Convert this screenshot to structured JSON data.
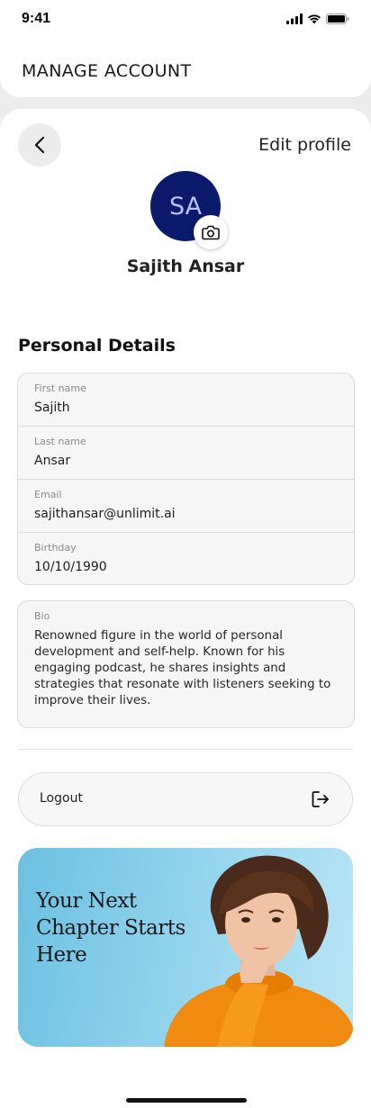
{
  "status_bar": {
    "time": "9:41"
  },
  "header": {
    "title": "MANAGE ACCOUNT"
  },
  "profile": {
    "edit_label": "Edit profile",
    "initials": "SA",
    "name": "Sajith Ansar"
  },
  "personal_details": {
    "title": "Personal Details",
    "fields": [
      {
        "label": "First name",
        "value": "Sajith"
      },
      {
        "label": "Last name",
        "value": "Ansar"
      },
      {
        "label": "Email",
        "value": "sajithansar@unlimit.ai"
      },
      {
        "label": "Birthday",
        "value": "10/10/1990"
      }
    ],
    "bio": {
      "label": "Bio",
      "value": "Renowned figure in the world of personal development and self-help. Known for his engaging podcast, he shares insights and strategies that resonate with listeners seeking to improve their lives."
    }
  },
  "logout": {
    "label": "Logout"
  },
  "promo": {
    "text": "Your Next Chapter Starts Here"
  },
  "colors": {
    "avatar_bg": "#0b1a6b",
    "page_bg": "#ececec",
    "card_bg": "#f6f6f6",
    "promo_bg": "#8fd2ec",
    "sweater": "#f08a10"
  },
  "icons": {
    "back": "chevron-left-icon",
    "camera": "camera-icon",
    "logout": "logout-icon",
    "signal": "signal-icon",
    "wifi": "wifi-icon",
    "battery": "battery-icon"
  }
}
